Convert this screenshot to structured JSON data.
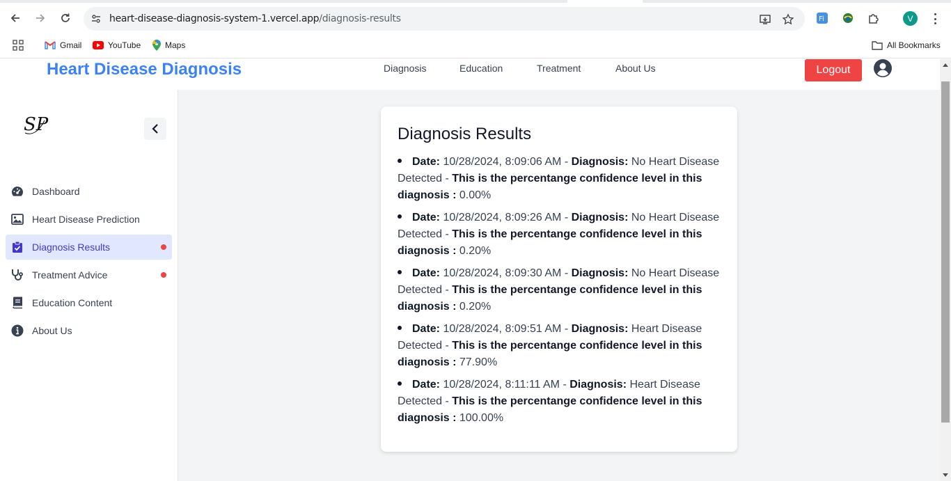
{
  "browser": {
    "url_host": "heart-disease-diagnosis-system-1.vercel.app",
    "url_path": "/diagnosis-results",
    "profile_initial": "V",
    "bookmarks": [
      {
        "label": "Gmail",
        "icon": "gmail-icon"
      },
      {
        "label": "YouTube",
        "icon": "youtube-icon"
      },
      {
        "label": "Maps",
        "icon": "maps-icon"
      }
    ],
    "all_bookmarks_label": "All Bookmarks"
  },
  "header": {
    "brand": "Heart Disease Diagnosis",
    "nav": [
      "Diagnosis",
      "Education",
      "Treatment",
      "About Us"
    ],
    "logout_label": "Logout"
  },
  "sidebar": {
    "logo_text": "SP",
    "items": [
      {
        "label": "Dashboard",
        "icon": "gauge-icon",
        "active": false,
        "dot": false
      },
      {
        "label": "Heart Disease Prediction",
        "icon": "image-icon",
        "active": false,
        "dot": false
      },
      {
        "label": "Diagnosis Results",
        "icon": "clipboard-check-icon",
        "active": true,
        "dot": true
      },
      {
        "label": "Treatment Advice",
        "icon": "stethoscope-icon",
        "active": false,
        "dot": true
      },
      {
        "label": "Education Content",
        "icon": "book-icon",
        "active": false,
        "dot": false
      },
      {
        "label": "About Us",
        "icon": "info-icon",
        "active": false,
        "dot": false
      }
    ]
  },
  "results": {
    "title": "Diagnosis Results",
    "date_label": "Date:",
    "diagnosis_label": "Diagnosis:",
    "confidence_label": "This is the percentange confidence level in this diagnosis :",
    "entries": [
      {
        "date": "10/28/2024, 8:09:06 AM",
        "diagnosis": "No Heart Disease Detected",
        "confidence": "0.00%"
      },
      {
        "date": "10/28/2024, 8:09:26 AM",
        "diagnosis": "No Heart Disease Detected",
        "confidence": "0.20%"
      },
      {
        "date": "10/28/2024, 8:09:30 AM",
        "diagnosis": "No Heart Disease Detected",
        "confidence": "0.20%"
      },
      {
        "date": "10/28/2024, 8:09:51 AM",
        "diagnosis": "Heart Disease Detected",
        "confidence": "77.90%"
      },
      {
        "date": "10/28/2024, 8:11:11 AM",
        "diagnosis": "Heart Disease Detected",
        "confidence": "100.00%"
      }
    ]
  },
  "colors": {
    "brand": "#3b82f6",
    "logout": "#ef4444",
    "active_bg": "#e0e7ff",
    "active_text": "#4338ca",
    "notification_dot": "#ef4444"
  }
}
